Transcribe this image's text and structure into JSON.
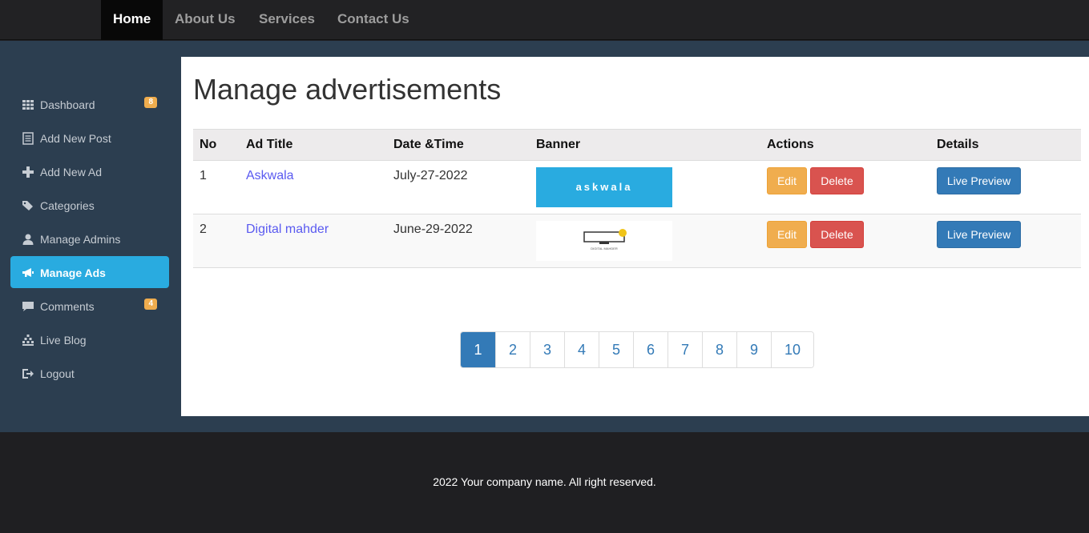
{
  "topnav": {
    "items": [
      {
        "label": "Home",
        "active": true
      },
      {
        "label": "About Us",
        "active": false
      },
      {
        "label": "Services",
        "active": false
      },
      {
        "label": "Contact Us",
        "active": false
      }
    ]
  },
  "sidebar": {
    "items": [
      {
        "label": "Dashboard",
        "icon": "grid-icon",
        "badge": "8"
      },
      {
        "label": "Add New Post",
        "icon": "list-icon"
      },
      {
        "label": "Add New Ad",
        "icon": "plus-icon"
      },
      {
        "label": "Categories",
        "icon": "tags-icon"
      },
      {
        "label": "Manage Admins",
        "icon": "user-icon"
      },
      {
        "label": "Manage Ads",
        "icon": "bullhorn-icon",
        "active": true
      },
      {
        "label": "Comments",
        "icon": "comment-icon",
        "badge": "4"
      },
      {
        "label": "Live Blog",
        "icon": "stats-icon"
      },
      {
        "label": "Logout",
        "icon": "logout-icon"
      }
    ]
  },
  "main": {
    "title": "Manage advertisements",
    "table": {
      "headers": [
        "No",
        "Ad Title",
        "Date &Time",
        "Banner",
        "Actions",
        "Details"
      ],
      "rows": [
        {
          "no": "1",
          "title": "Askwala",
          "date": "July-27-2022",
          "banner_text": "askwala"
        },
        {
          "no": "2",
          "title": "Digital mahder",
          "date": "June-29-2022",
          "banner_text": "DIGITAL MAHDER"
        }
      ],
      "actions": {
        "edit": "Edit",
        "delete": "Delete",
        "preview": "Live Preview"
      }
    },
    "pagination": [
      "1",
      "2",
      "3",
      "4",
      "5",
      "6",
      "7",
      "8",
      "9",
      "10"
    ],
    "current_page": "1"
  },
  "footer": {
    "text": "2022 Your company name. All right reserved."
  },
  "colors": {
    "nav_bg": "#222224",
    "band_bg": "#2c3e50",
    "sidebar_active": "#29abe0",
    "badge": "#f0ad4e",
    "edit": "#f0ad4e",
    "delete": "#d9534f",
    "primary": "#337ab7",
    "link": "#5a5af0"
  }
}
